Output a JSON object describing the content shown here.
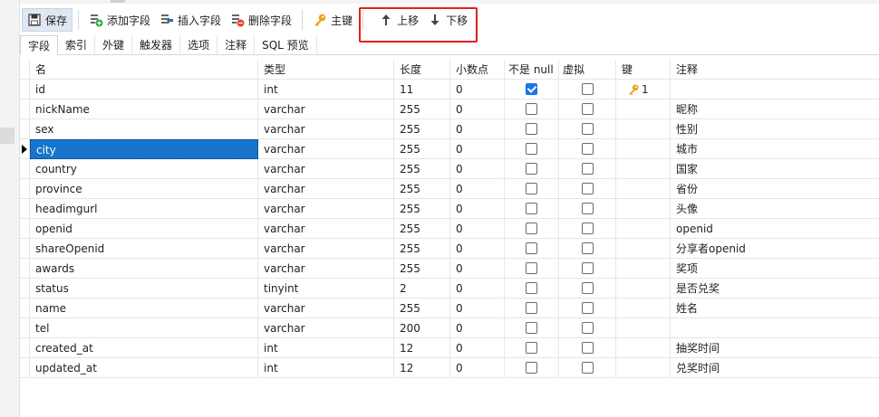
{
  "toolbar": {
    "save": "保存",
    "add_field": "添加字段",
    "insert_field": "插入字段",
    "delete_field": "删除字段",
    "primary_key": "主键",
    "move_up": "上移",
    "move_down": "下移"
  },
  "tabs": [
    "字段",
    "索引",
    "外键",
    "触发器",
    "选项",
    "注释",
    "SQL 预览"
  ],
  "columns": [
    "名",
    "类型",
    "长度",
    "小数点",
    "不是 null",
    "虚拟",
    "键",
    "注释"
  ],
  "rows": [
    {
      "name": "id",
      "type": "int",
      "length": "11",
      "decimal": "0",
      "not_null": true,
      "virtual": false,
      "key": "1",
      "comment": ""
    },
    {
      "name": "nickName",
      "type": "varchar",
      "length": "255",
      "decimal": "0",
      "not_null": false,
      "virtual": false,
      "key": "",
      "comment": "昵称"
    },
    {
      "name": "sex",
      "type": "varchar",
      "length": "255",
      "decimal": "0",
      "not_null": false,
      "virtual": false,
      "key": "",
      "comment": "性别"
    },
    {
      "name": "city",
      "type": "varchar",
      "length": "255",
      "decimal": "0",
      "not_null": false,
      "virtual": false,
      "key": "",
      "comment": "城市"
    },
    {
      "name": "country",
      "type": "varchar",
      "length": "255",
      "decimal": "0",
      "not_null": false,
      "virtual": false,
      "key": "",
      "comment": "国家"
    },
    {
      "name": "province",
      "type": "varchar",
      "length": "255",
      "decimal": "0",
      "not_null": false,
      "virtual": false,
      "key": "",
      "comment": "省份"
    },
    {
      "name": "headimgurl",
      "type": "varchar",
      "length": "255",
      "decimal": "0",
      "not_null": false,
      "virtual": false,
      "key": "",
      "comment": "头像"
    },
    {
      "name": "openid",
      "type": "varchar",
      "length": "255",
      "decimal": "0",
      "not_null": false,
      "virtual": false,
      "key": "",
      "comment": "openid"
    },
    {
      "name": "shareOpenid",
      "type": "varchar",
      "length": "255",
      "decimal": "0",
      "not_null": false,
      "virtual": false,
      "key": "",
      "comment": "分享者openid"
    },
    {
      "name": "awards",
      "type": "varchar",
      "length": "255",
      "decimal": "0",
      "not_null": false,
      "virtual": false,
      "key": "",
      "comment": "奖项"
    },
    {
      "name": "status",
      "type": "tinyint",
      "length": "2",
      "decimal": "0",
      "not_null": false,
      "virtual": false,
      "key": "",
      "comment": "是否兑奖"
    },
    {
      "name": "name",
      "type": "varchar",
      "length": "255",
      "decimal": "0",
      "not_null": false,
      "virtual": false,
      "key": "",
      "comment": "姓名"
    },
    {
      "name": "tel",
      "type": "varchar",
      "length": "200",
      "decimal": "0",
      "not_null": false,
      "virtual": false,
      "key": "",
      "comment": ""
    },
    {
      "name": "created_at",
      "type": "int",
      "length": "12",
      "decimal": "0",
      "not_null": false,
      "virtual": false,
      "key": "",
      "comment": "抽奖时间"
    },
    {
      "name": "updated_at",
      "type": "int",
      "length": "12",
      "decimal": "0",
      "not_null": false,
      "virtual": false,
      "key": "",
      "comment": "兑奖时间"
    }
  ],
  "selected_row": "city",
  "colors": {
    "selection": "#1874cd",
    "highlight_box": "#e02020",
    "checkbox_on": "#1a73e8",
    "key_icon": "#e8a317"
  }
}
